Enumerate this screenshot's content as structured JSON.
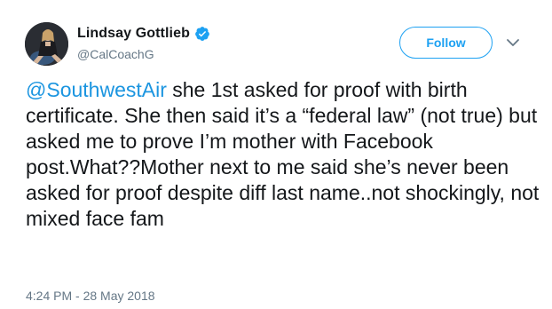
{
  "author": {
    "display_name": "Lindsay Gottlieb",
    "handle": "@CalCoachG"
  },
  "follow_button_label": "Follow",
  "icons": {
    "verified": "verified-badge-icon",
    "menu": "chevron-down-icon"
  },
  "tweet": {
    "mention": "@SouthwestAir",
    "text": " she 1st asked for proof with birth certificate. She then said it’s a “federal law” (not true) but asked me to prove I’m mother with Facebook post.What??Mother next to me said she’s never been asked for proof despite diff last name..not shockingly, not mixed face fam",
    "timestamp": "4:24 PM - 28 May 2018"
  },
  "colors": {
    "accent": "#1da1f2",
    "mention": "#1b95e0",
    "secondary_text": "#657786",
    "primary_text": "#14171a"
  }
}
